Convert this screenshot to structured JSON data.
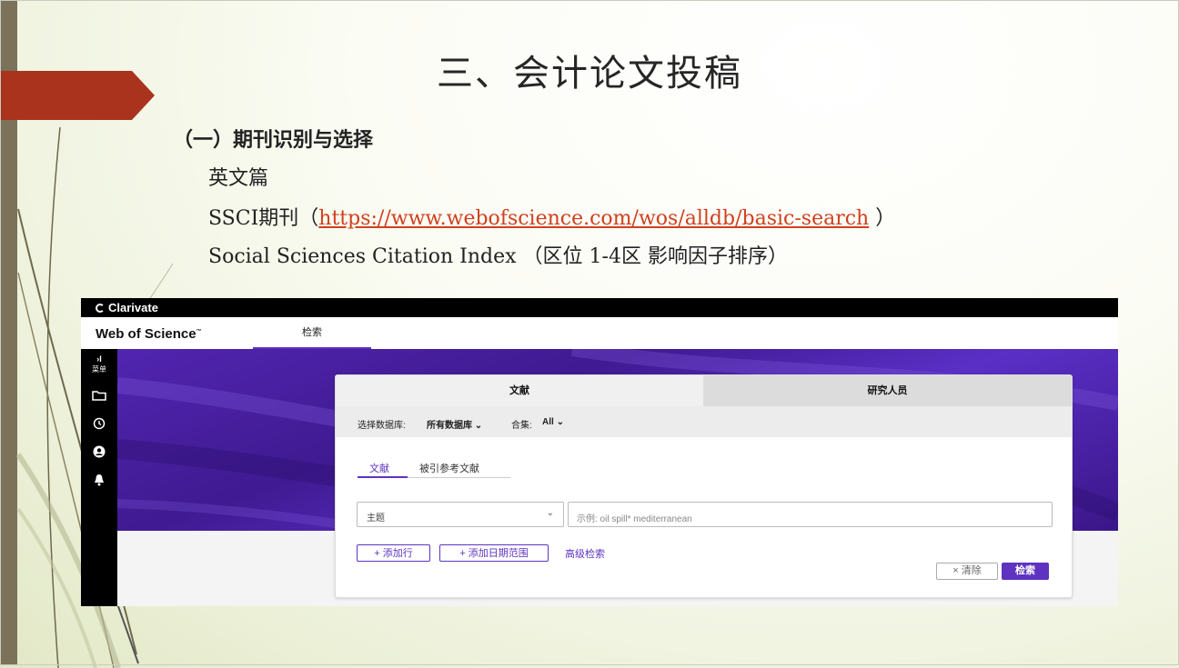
{
  "slide": {
    "title": "三、会计论文投稿",
    "heading": "（一）期刊识别与选择",
    "line_english": "英文篇",
    "ssci_prefix": "SSCI期刊（",
    "ssci_link": "https://www.webofscience.com/wos/alldb/basic-search",
    "ssci_suffix": " ）",
    "ssci_index": "Social Sciences Citation Index （区位 1-4区 影响因子排序）"
  },
  "screenshot": {
    "brand": "Clarivate",
    "product": "Web of Science",
    "product_tm": "™",
    "nav_tab": "检索",
    "sidebar": {
      "expand": "›I",
      "menu_label": "菜单",
      "icons": [
        "folder-icon",
        "history-icon",
        "account-icon",
        "bell-icon"
      ]
    },
    "card": {
      "tab_documents": "文献",
      "tab_researchers": "研究人员",
      "db_label": "选择数据库:",
      "db_value": "所有数据库",
      "collection_label": "合集:",
      "collection_value": "All",
      "subtab_documents": "文献",
      "subtab_cited": "被引参考文献",
      "field_value": "主题",
      "search_placeholder": "示例: oil spill* mediterranean",
      "add_row": "+ 添加行",
      "add_date": "+ 添加日期范围",
      "advanced": "高级检索",
      "clear": "× 清除",
      "search": "检索"
    }
  },
  "colors": {
    "accent_red": "#a9331c",
    "left_bar": "#7b7259",
    "wos_purple": "#5e33bf",
    "link": "#d0401d"
  }
}
